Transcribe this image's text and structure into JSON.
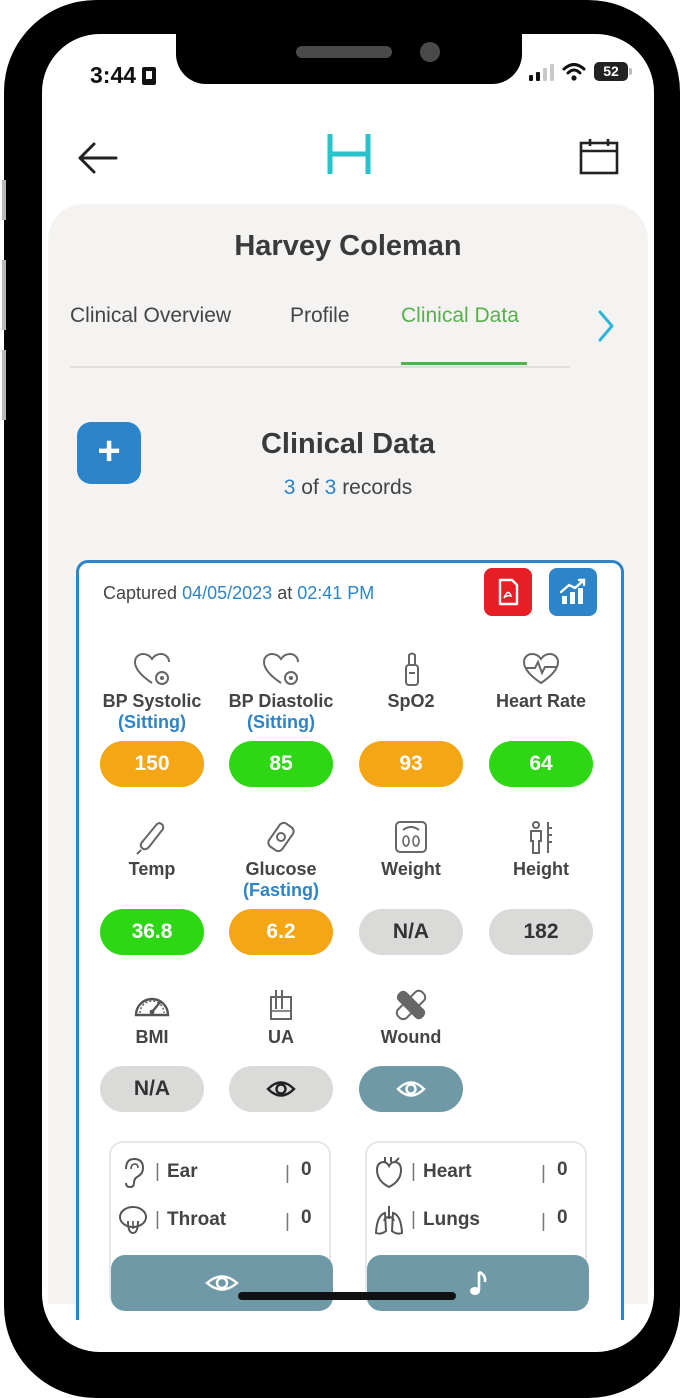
{
  "status_bar": {
    "time": "3:44",
    "battery": "52"
  },
  "patient": {
    "name": "Harvey Coleman"
  },
  "tabs": [
    {
      "label": "Clinical Overview"
    },
    {
      "label": "Profile"
    },
    {
      "label": "Clinical Data"
    }
  ],
  "section": {
    "title": "Clinical Data",
    "records_current": "3",
    "records_of": "of",
    "records_total": "3",
    "records_suffix": "records",
    "add_label": "+"
  },
  "record": {
    "captured_prefix": "Captured",
    "date": "04/05/2023",
    "at": "at",
    "time": "02:41 PM"
  },
  "metrics": {
    "bp_systolic": {
      "label": "BP Systolic",
      "sub": "(Sitting)",
      "value": "150",
      "status": "orange"
    },
    "bp_diastolic": {
      "label": "BP Diastolic",
      "sub": "(Sitting)",
      "value": "85",
      "status": "green"
    },
    "spo2": {
      "label": "SpO2",
      "value": "93",
      "status": "orange"
    },
    "heart_rate": {
      "label": "Heart Rate",
      "value": "64",
      "status": "green"
    },
    "temp": {
      "label": "Temp",
      "value": "36.8",
      "status": "green"
    },
    "glucose": {
      "label": "Glucose",
      "sub": "(Fasting)",
      "value": "6.2",
      "status": "orange"
    },
    "weight": {
      "label": "Weight",
      "value": "N/A",
      "status": "grey"
    },
    "height": {
      "label": "Height",
      "value": "182",
      "status": "grey"
    },
    "bmi": {
      "label": "BMI",
      "value": "N/A",
      "status": "grey"
    },
    "ua": {
      "label": "UA",
      "icon": "eye-icon"
    },
    "wound": {
      "label": "Wound",
      "icon": "eye-icon"
    }
  },
  "exam": {
    "left": [
      {
        "name": "Ear",
        "value": "0",
        "icon": "ear-icon"
      },
      {
        "name": "Throat",
        "value": "0",
        "icon": "throat-icon"
      }
    ],
    "right": [
      {
        "name": "Heart",
        "value": "0",
        "icon": "heart-organ-icon"
      },
      {
        "name": "Lungs",
        "value": "0",
        "icon": "lungs-icon"
      }
    ],
    "left_button_icon": "eye-icon",
    "right_button_icon": "music-note-icon"
  },
  "colors": {
    "accent_blue": "#2d84c8",
    "accent_green": "#56b14a",
    "status_orange": "#f5a614",
    "status_green": "#2ed714",
    "neutral_grey": "#dadad9",
    "teal_button": "#6f99a7",
    "pdf_red": "#e51f25",
    "logo_teal": "#27c3c8"
  }
}
